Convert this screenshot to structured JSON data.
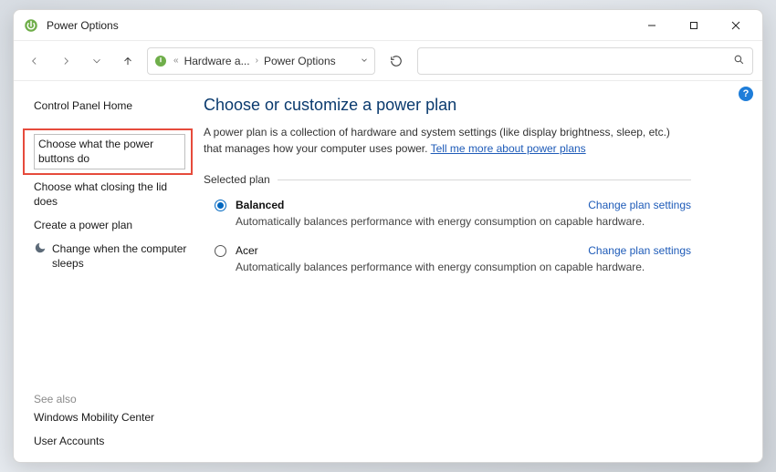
{
  "window": {
    "title": "Power Options"
  },
  "breadcrumb": {
    "prefix": "«",
    "crumb1": "Hardware a...",
    "crumb2": "Power Options"
  },
  "help": "?",
  "sidebar": {
    "control_panel_home": "Control Panel Home",
    "choose_power_buttons": "Choose what the power buttons do",
    "choose_closing_lid": "Choose what closing the lid does",
    "create_plan": "Create a power plan",
    "change_sleep": "Change when the computer sleeps",
    "see_also": "See also",
    "mobility_center": "Windows Mobility Center",
    "user_accounts": "User Accounts"
  },
  "main": {
    "heading": "Choose or customize a power plan",
    "desc_pre": "A power plan is a collection of hardware and system settings (like display brightness, sleep, etc.) that manages how your computer uses power. ",
    "desc_link": "Tell me more about power plans",
    "group_label": "Selected plan",
    "plans": [
      {
        "name": "Balanced",
        "selected": true,
        "link": "Change plan settings",
        "desc": "Automatically balances performance with energy consumption on capable hardware."
      },
      {
        "name": "Acer",
        "selected": false,
        "link": "Change plan settings",
        "desc": "Automatically balances performance with energy consumption on capable hardware."
      }
    ]
  }
}
